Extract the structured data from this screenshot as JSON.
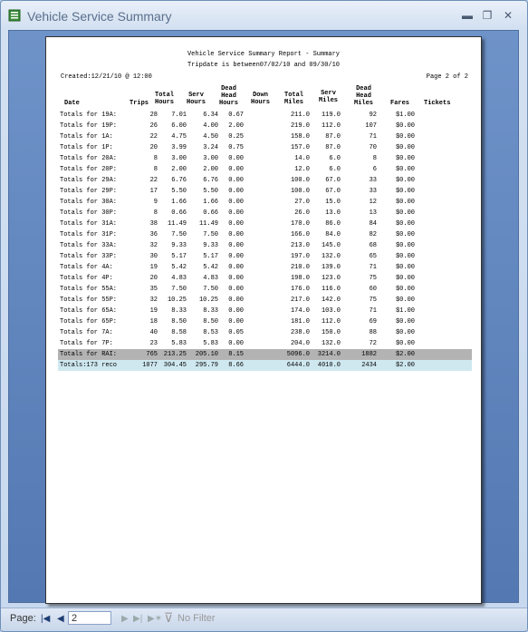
{
  "window": {
    "title": "Vehicle Service Summary",
    "minimize": "▬",
    "restore": "❐",
    "close": "✕"
  },
  "report": {
    "title": "Vehicle Service Summary Report - Summary",
    "subtitle": "Tripdate is between07/02/10 and 09/30/10",
    "created": "Created:12/21/10 @ 12:00",
    "page": "Page 2 of 2",
    "headers": {
      "date": "Date",
      "trips": "Trips",
      "total_hours": [
        "Total",
        "Hours"
      ],
      "serv_hours": [
        "Serv",
        "Hours"
      ],
      "dead_head_hours": [
        "Dead",
        "Head",
        "Hours"
      ],
      "down_hours": [
        "Down",
        "Hours"
      ],
      "total_miles": [
        "Total",
        "Miles"
      ],
      "serv_miles": [
        "Serv",
        "Miles"
      ],
      "dead_head_miles": [
        "Dead",
        "Head",
        "Miles"
      ],
      "fares": "Fares",
      "tickets": "Tickets"
    },
    "rows": [
      [
        "Totals for 19A:",
        "28",
        "7.01",
        "6.34",
        "0.67",
        "",
        "211.0",
        "119.0",
        "92",
        "$1.00"
      ],
      [
        "Totals for 19P:",
        "26",
        "6.00",
        "4.00",
        "2.00",
        "",
        "219.0",
        "112.0",
        "107",
        "$0.00"
      ],
      [
        "Totals for 1A:",
        "22",
        "4.75",
        "4.50",
        "0.25",
        "",
        "158.0",
        "87.0",
        "71",
        "$0.00"
      ],
      [
        "Totals for 1P:",
        "20",
        "3.99",
        "3.24",
        "0.75",
        "",
        "157.0",
        "87.0",
        "70",
        "$0.00"
      ],
      [
        "Totals for 20A:",
        "8",
        "3.00",
        "3.00",
        "0.00",
        "",
        "14.0",
        "6.0",
        "8",
        "$0.00"
      ],
      [
        "Totals for 20P:",
        "8",
        "2.00",
        "2.00",
        "0.00",
        "",
        "12.0",
        "6.0",
        "6",
        "$0.00"
      ],
      [
        "Totals for 29A:",
        "22",
        "6.76",
        "6.76",
        "0.00",
        "",
        "100.0",
        "67.0",
        "33",
        "$0.00"
      ],
      [
        "Totals for 29P:",
        "17",
        "5.50",
        "5.50",
        "0.00",
        "",
        "100.0",
        "67.0",
        "33",
        "$0.00"
      ],
      [
        "Totals for 30A:",
        "9",
        "1.66",
        "1.66",
        "0.00",
        "",
        "27.0",
        "15.0",
        "12",
        "$0.00"
      ],
      [
        "Totals for 30P:",
        "8",
        "0.66",
        "0.66",
        "0.00",
        "",
        "26.0",
        "13.0",
        "13",
        "$0.00"
      ],
      [
        "Totals for 31A:",
        "38",
        "11.49",
        "11.49",
        "0.00",
        "",
        "170.0",
        "86.0",
        "84",
        "$0.00"
      ],
      [
        "Totals for 31P:",
        "36",
        "7.50",
        "7.50",
        "0.00",
        "",
        "166.0",
        "84.0",
        "82",
        "$0.00"
      ],
      [
        "Totals for 33A:",
        "32",
        "9.33",
        "9.33",
        "0.00",
        "",
        "213.0",
        "145.0",
        "68",
        "$0.00"
      ],
      [
        "Totals for 33P:",
        "30",
        "5.17",
        "5.17",
        "0.00",
        "",
        "197.0",
        "132.0",
        "65",
        "$0.00"
      ],
      [
        "Totals for 4A:",
        "19",
        "5.42",
        "5.42",
        "0.00",
        "",
        "210.0",
        "139.0",
        "71",
        "$0.00"
      ],
      [
        "Totals for 4P:",
        "20",
        "4.83",
        "4.83",
        "0.00",
        "",
        "198.0",
        "123.0",
        "75",
        "$0.00"
      ],
      [
        "Totals for 55A:",
        "35",
        "7.50",
        "7.50",
        "0.00",
        "",
        "176.0",
        "116.0",
        "60",
        "$0.00"
      ],
      [
        "Totals for 55P:",
        "32",
        "10.25",
        "10.25",
        "0.00",
        "",
        "217.0",
        "142.0",
        "75",
        "$0.00"
      ],
      [
        "Totals for 65A:",
        "19",
        "8.33",
        "8.33",
        "0.00",
        "",
        "174.0",
        "103.0",
        "71",
        "$1.00"
      ],
      [
        "Totals for 65P:",
        "18",
        "8.50",
        "8.50",
        "0.00",
        "",
        "181.0",
        "112.0",
        "69",
        "$0.00"
      ],
      [
        "Totals for 7A:",
        "40",
        "8.58",
        "8.53",
        "0.05",
        "",
        "238.0",
        "150.0",
        "88",
        "$0.00"
      ],
      [
        "Totals for 7P:",
        "23",
        "5.83",
        "5.83",
        "0.00",
        "",
        "204.0",
        "132.0",
        "72",
        "$0.00"
      ]
    ],
    "rai_total": [
      "Totals for RAI:",
      "765",
      "213.25",
      "205.10",
      "8.15",
      "",
      "5096.0",
      "3214.0",
      "1882",
      "$2.00"
    ],
    "grand_total": [
      "Totals:173 reco",
      "1077",
      "304.45",
      "295.79",
      "8.66",
      "",
      "6444.0",
      "4010.0",
      "2434",
      "$2.00"
    ]
  },
  "statusbar": {
    "page_label": "Page:",
    "page_value": "2",
    "filter_label": "No Filter"
  }
}
